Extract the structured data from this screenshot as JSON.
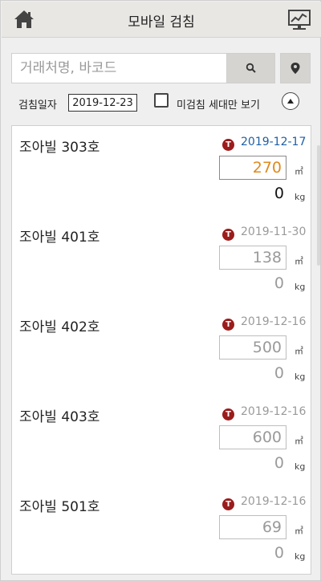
{
  "header": {
    "title": "모바일 검침",
    "home_icon": "home-icon",
    "monitor_icon": "chart-monitor-icon"
  },
  "search": {
    "placeholder": "거래처명, 바코드",
    "search_icon": "search-icon",
    "location_icon": "location-pin-icon"
  },
  "filter": {
    "date_label": "검침일자",
    "date_value": "2019-12-23",
    "unread_only_label": "미검침 세대만 보기",
    "unread_only_checked": false,
    "collapse_icon": "chevron-up-icon"
  },
  "colors": {
    "badge": "#9b1c1c",
    "active_date": "#1d5fa8",
    "active_value": "#e08a1e"
  },
  "items": [
    {
      "name": "조아빌 303호",
      "badge": "T",
      "date": "2019-12-17",
      "value": "270",
      "unit_m3": "㎥",
      "kg": "0",
      "unit_kg": "kg"
    },
    {
      "name": "조아빌 401호",
      "badge": "T",
      "date": "2019-11-30",
      "value": "138",
      "unit_m3": "㎥",
      "kg": "0",
      "unit_kg": "kg"
    },
    {
      "name": "조아빌 402호",
      "badge": "T",
      "date": "2019-12-16",
      "value": "500",
      "unit_m3": "㎥",
      "kg": "0",
      "unit_kg": "kg"
    },
    {
      "name": "조아빌 403호",
      "badge": "T",
      "date": "2019-12-16",
      "value": "600",
      "unit_m3": "㎥",
      "kg": "0",
      "unit_kg": "kg"
    },
    {
      "name": "조아빌 501호",
      "badge": "T",
      "date": "2019-12-16",
      "value": "69",
      "unit_m3": "㎥",
      "kg": "0",
      "unit_kg": "kg"
    }
  ]
}
